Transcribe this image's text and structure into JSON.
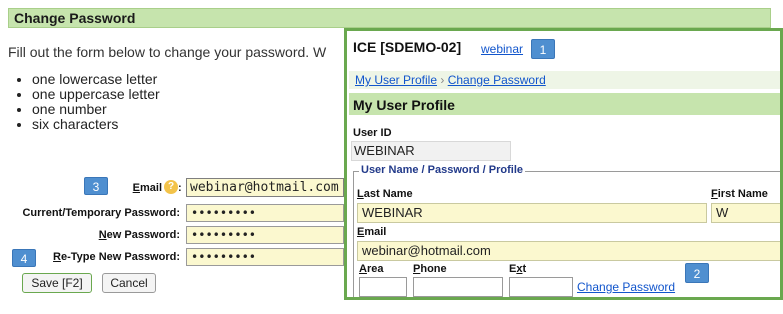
{
  "page": {
    "header_title": "Change Password",
    "intro_text": "Fill out the form below to change your password. W",
    "requirements": [
      "one lowercase letter",
      "one uppercase letter",
      "one number",
      "six characters"
    ]
  },
  "form": {
    "email_label_prefix": "E",
    "email_label_rest": "mail",
    "email_value": "webinar@hotmail.com",
    "help_icon": "?",
    "current_pw_label": "Current/Temporary Password:",
    "current_pw_value": "•••••••••",
    "new_pw_label_u": "N",
    "new_pw_label_rest": "ew Password:",
    "new_pw_value": "•••••••••",
    "retype_label_u": "R",
    "retype_label_rest": "e-Type New Password:",
    "retype_value": "•••••••••",
    "save_label": "Save [F2]",
    "cancel_label": "Cancel"
  },
  "badges": {
    "b1": "1",
    "b2": "2",
    "b3": "3",
    "b4": "4"
  },
  "overlay": {
    "title": "ICE [SDEMO-02]",
    "user_link": "webinar",
    "breadcrumb_profile": "My User Profile",
    "breadcrumb_sep": "›",
    "breadcrumb_current": "Change Password",
    "section_title": "My User Profile",
    "user_id_label": "User ID",
    "user_id_value": "WEBINAR",
    "fieldset_legend": "User Name / Password / Profile",
    "last_name_label_u": "L",
    "last_name_label_rest": "ast Name",
    "last_name_value": "WEBINAR",
    "first_name_label_u": "F",
    "first_name_label_rest": "irst Name",
    "first_name_value": "W",
    "email_label_u": "E",
    "email_label_rest": "mail",
    "email_value": "webinar@hotmail.com",
    "area_label_u": "A",
    "area_label_rest": "rea",
    "phone_label_u": "P",
    "phone_label_rest": "hone",
    "ext_label_u": "x",
    "ext_label_pre": "E",
    "ext_label_rest": "t",
    "change_password_link": "Change Password"
  },
  "colors": {
    "accent_green": "#c6e4ad",
    "badge_blue": "#4f8fd0",
    "input_yellow": "#fbf8cf",
    "link_blue": "#1155cc"
  }
}
